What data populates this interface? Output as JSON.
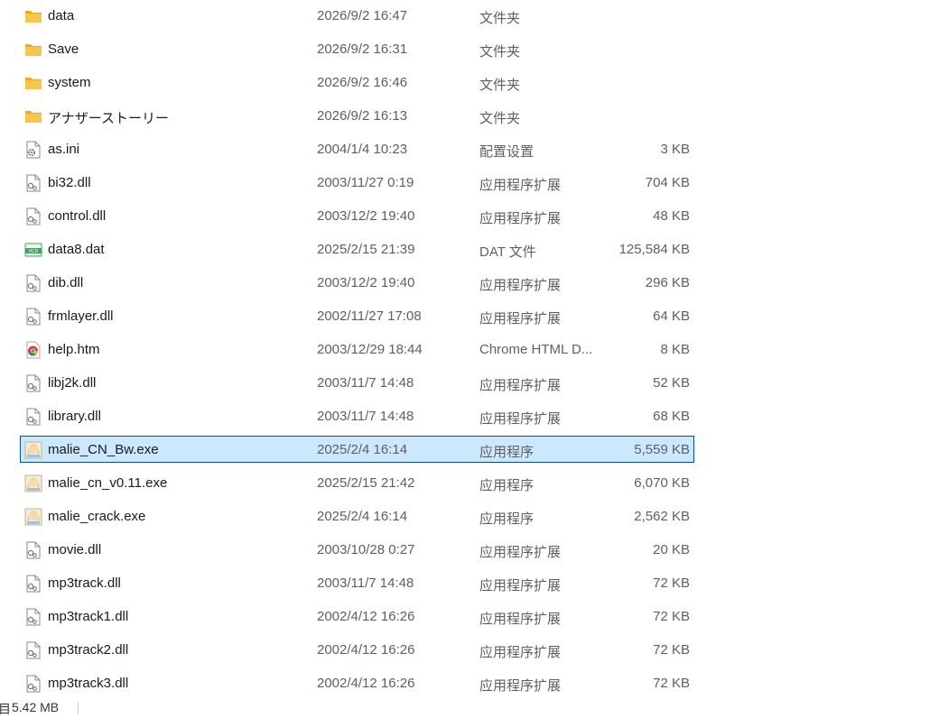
{
  "files": [
    {
      "name": "data",
      "modified": "2026/9/2 16:47",
      "type": "文件夹",
      "size": "",
      "icon": "folder-icon"
    },
    {
      "name": "Save",
      "modified": "2026/9/2 16:31",
      "type": "文件夹",
      "size": "",
      "icon": "folder-icon"
    },
    {
      "name": "system",
      "modified": "2026/9/2 16:46",
      "type": "文件夹",
      "size": "",
      "icon": "folder-icon"
    },
    {
      "name": "アナザーストーリー",
      "modified": "2026/9/2 16:13",
      "type": "文件夹",
      "size": "",
      "icon": "folder-icon"
    },
    {
      "name": "as.ini",
      "modified": "2004/1/4 10:23",
      "type": "配置设置",
      "size": "3 KB",
      "icon": "config-file-icon"
    },
    {
      "name": "bi32.dll",
      "modified": "2003/11/27 0:19",
      "type": "应用程序扩展",
      "size": "704 KB",
      "icon": "dll-file-icon"
    },
    {
      "name": "control.dll",
      "modified": "2003/12/2 19:40",
      "type": "应用程序扩展",
      "size": "48 KB",
      "icon": "dll-file-icon"
    },
    {
      "name": "data8.dat",
      "modified": "2025/2/15 21:39",
      "type": "DAT 文件",
      "size": "125,584 KB",
      "icon": "dat-file-icon"
    },
    {
      "name": "dib.dll",
      "modified": "2003/12/2 19:40",
      "type": "应用程序扩展",
      "size": "296 KB",
      "icon": "dll-file-icon"
    },
    {
      "name": "frmlayer.dll",
      "modified": "2002/11/27 17:08",
      "type": "应用程序扩展",
      "size": "64 KB",
      "icon": "dll-file-icon"
    },
    {
      "name": "help.htm",
      "modified": "2003/12/29 18:44",
      "type": "Chrome HTML D...",
      "size": "8 KB",
      "icon": "chrome-html-icon"
    },
    {
      "name": "libj2k.dll",
      "modified": "2003/11/7 14:48",
      "type": "应用程序扩展",
      "size": "52 KB",
      "icon": "dll-file-icon"
    },
    {
      "name": "library.dll",
      "modified": "2003/11/7 14:48",
      "type": "应用程序扩展",
      "size": "68 KB",
      "icon": "dll-file-icon"
    },
    {
      "name": "malie_CN_Bw.exe",
      "modified": "2025/2/4 16:14",
      "type": "应用程序",
      "size": "5,559 KB",
      "icon": "exe-app-icon",
      "selected": true
    },
    {
      "name": "malie_cn_v0.11.exe",
      "modified": "2025/2/15 21:42",
      "type": "应用程序",
      "size": "6,070 KB",
      "icon": "exe-app-icon"
    },
    {
      "name": "malie_crack.exe",
      "modified": "2025/2/4 16:14",
      "type": "应用程序",
      "size": "2,562 KB",
      "icon": "exe-app-icon"
    },
    {
      "name": "movie.dll",
      "modified": "2003/10/28 0:27",
      "type": "应用程序扩展",
      "size": "20 KB",
      "icon": "dll-file-icon"
    },
    {
      "name": "mp3track.dll",
      "modified": "2003/11/7 14:48",
      "type": "应用程序扩展",
      "size": "72 KB",
      "icon": "dll-file-icon"
    },
    {
      "name": "mp3track1.dll",
      "modified": "2002/4/12 16:26",
      "type": "应用程序扩展",
      "size": "72 KB",
      "icon": "dll-file-icon"
    },
    {
      "name": "mp3track2.dll",
      "modified": "2002/4/12 16:26",
      "type": "应用程序扩展",
      "size": "72 KB",
      "icon": "dll-file-icon"
    },
    {
      "name": "mp3track3.dll",
      "modified": "2002/4/12 16:26",
      "type": "应用程序扩展",
      "size": "72 KB",
      "icon": "dll-file-icon"
    }
  ],
  "status": {
    "glyph": "目",
    "selected_size": "5.42 MB"
  },
  "colors": {
    "selection_bg": "#cce8ff",
    "selection_border": "#0b4f86",
    "folder": "#f8c64a",
    "secondary_text": "#5f5f5f"
  }
}
